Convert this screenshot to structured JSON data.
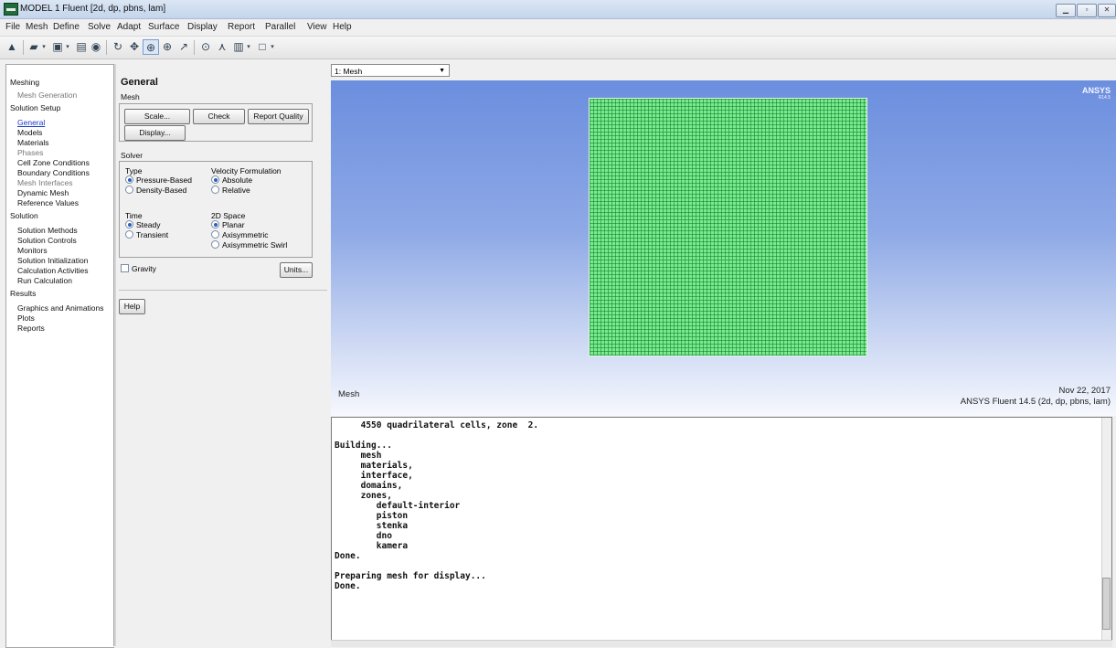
{
  "window": {
    "title": "MODEL 1 Fluent [2d, dp, pbns, lam]"
  },
  "menubar": [
    "File",
    "Mesh",
    "Define",
    "Solve",
    "Adapt",
    "Surface",
    "Display",
    "Report",
    "Parallel",
    "View",
    "Help"
  ],
  "tree": {
    "meshing": "Meshing",
    "mesh_generation": "Mesh Generation",
    "solution_setup": "Solution Setup",
    "general": "General",
    "models": "Models",
    "materials": "Materials",
    "phases": "Phases",
    "cell_zone_conditions": "Cell Zone Conditions",
    "boundary_conditions": "Boundary Conditions",
    "mesh_interfaces": "Mesh Interfaces",
    "dynamic_mesh": "Dynamic Mesh",
    "reference_values": "Reference Values",
    "solution": "Solution",
    "solution_methods": "Solution Methods",
    "solution_controls": "Solution Controls",
    "monitors": "Monitors",
    "solution_initialization": "Solution Initialization",
    "calculation_activities": "Calculation Activities",
    "run_calculation": "Run Calculation",
    "results": "Results",
    "graphics_and_animations": "Graphics and Animations",
    "plots": "Plots",
    "reports": "Reports"
  },
  "panel": {
    "title": "General",
    "mesh_label": "Mesh",
    "scale_btn": "Scale...",
    "check_btn": "Check",
    "report_quality_btn": "Report Quality",
    "display_btn": "Display...",
    "solver_label": "Solver",
    "type_label": "Type",
    "pressure_based": "Pressure-Based",
    "density_based": "Density-Based",
    "velocity_label": "Velocity Formulation",
    "absolute": "Absolute",
    "relative": "Relative",
    "time_label": "Time",
    "steady": "Steady",
    "transient": "Transient",
    "space_label": "2D Space",
    "planar": "Planar",
    "axisymmetric": "Axisymmetric",
    "axisymmetric_swirl": "Axisymmetric Swirl",
    "gravity": "Gravity",
    "units_btn": "Units...",
    "help_btn": "Help"
  },
  "graphics": {
    "view_select": "1: Mesh",
    "logo": "ANSYS",
    "logo_sub": "R14.5",
    "caption": "Mesh",
    "date": "Nov 22, 2017",
    "version": "ANSYS Fluent 14.5 (2d, dp, pbns, lam)"
  },
  "console": {
    "text": "     4550 quadrilateral cells, zone  2.\n\nBuilding...\n     mesh\n     materials,\n     interface,\n     domains,\n     zones,\n        default-interior\n        piston\n        stenka\n        dno\n        kamera\nDone.\n\nPreparing mesh for display...\nDone."
  }
}
